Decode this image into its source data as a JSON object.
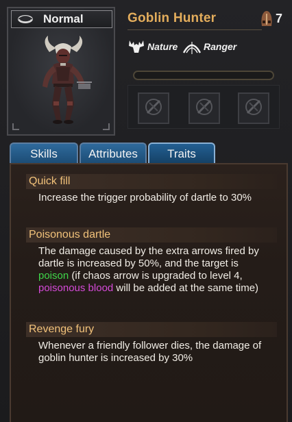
{
  "unit": {
    "rank": "Normal",
    "name": "Goblin Hunter",
    "cost": "7"
  },
  "tags": [
    {
      "icon": "moose-icon",
      "label": "Nature"
    },
    {
      "icon": "bow-icon",
      "label": "Ranger"
    }
  ],
  "slots": [
    "skill-slot-locked",
    "skill-slot-locked",
    "skill-slot-locked"
  ],
  "tabs": [
    {
      "label": "Skills",
      "active": false
    },
    {
      "label": "Attributes",
      "active": false
    },
    {
      "label": "Traits",
      "active": true
    }
  ],
  "traits": [
    {
      "title": "Quick fill",
      "desc_parts": [
        {
          "text": "Increase the trigger probability of dartle to 30%",
          "color": "default"
        }
      ]
    },
    {
      "title": "Poisonous dartle",
      "desc_parts": [
        {
          "text": "The damage caused by the extra arrows fired by dartle is increased by 50%, and the target is ",
          "color": "default"
        },
        {
          "text": "poison",
          "color": "green"
        },
        {
          "text": " (if chaos arrow is upgraded to level 4, ",
          "color": "default"
        },
        {
          "text": "poisonous blood",
          "color": "purple"
        },
        {
          "text": " will be added at the same time)",
          "color": "default"
        }
      ]
    },
    {
      "title": "Revenge fury",
      "desc_parts": [
        {
          "text": "Whenever a friendly follower dies, the damage of goblin hunter is increased by 30%",
          "color": "default"
        }
      ]
    }
  ],
  "colors": {
    "name": "#e3ad5c",
    "trait_title": "#f2c27a",
    "green": "#3fd84a",
    "purple": "#d64bd9",
    "tab_blue": "#235f92"
  }
}
